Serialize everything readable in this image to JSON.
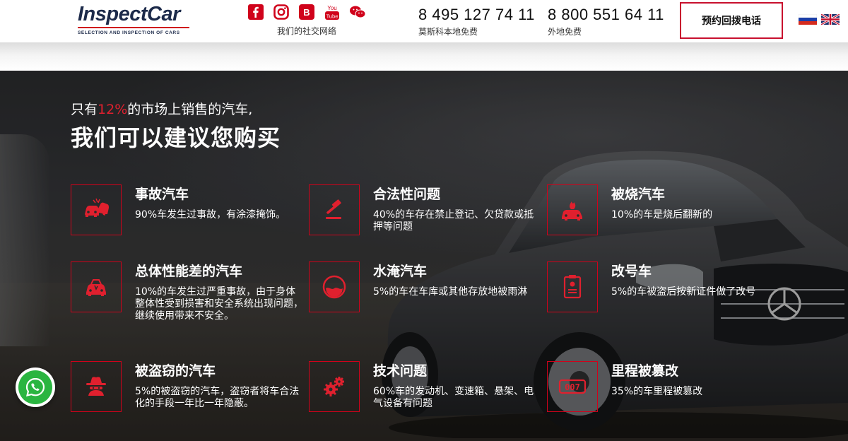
{
  "header": {
    "logo": {
      "name": "InspectCar",
      "tagline": "SELECTION AND INSPECTION OF CARS"
    },
    "social": {
      "icons": [
        "facebook-icon",
        "instagram-icon",
        "vk-icon",
        "youtube-icon",
        "wechat-icon"
      ],
      "label": "我们的社交网络"
    },
    "phones": [
      {
        "number": "8 495 127 74 11",
        "note": "莫斯科本地免费"
      },
      {
        "number": "8 800 551 64 11",
        "note": "外地免费"
      }
    ],
    "callback_label": "预约回拨电话",
    "languages": [
      "ru-flag",
      "uk-flag"
    ]
  },
  "hero": {
    "subtitle_prefix": "只有",
    "subtitle_highlight": "12%",
    "subtitle_suffix": "的市场上销售的汽车,",
    "title": "我们可以建议您购买",
    "accent_color": "#e0202e",
    "items": [
      {
        "title": "事故汽车",
        "desc": "90%车发生过事故，有涂漆掩饰。",
        "icon": "car-crash-icon"
      },
      {
        "title": "合法性问题",
        "desc": "40%的车存在禁止登记、欠贷款或抵押等问题",
        "icon": "gavel-icon"
      },
      {
        "title": "被烧汽车",
        "desc": "10%的车是烧后翻新的",
        "icon": "car-fire-icon"
      },
      {
        "title": "总体性能差的汽车",
        "desc": "10%的车发生过严重事故，由于身体整体性受到损害和安全系统出现问题，继续使用带来不安全。",
        "icon": "car-damaged-icon"
      },
      {
        "title": "水淹汽车",
        "desc": "5%的车在车库或其他存放地被雨淋",
        "icon": "water-icon"
      },
      {
        "title": "改号车",
        "desc": "5%的车被盗后按新证件做了改号",
        "icon": "document-icon"
      },
      {
        "title": "被盗窃的汽车",
        "desc": "5%的被盗窃的汽车，盗窃者将车合法化的手段一年比一年隐蔽。",
        "icon": "thief-icon"
      },
      {
        "title": "技术问题",
        "desc": "60%车的发动机、变速箱、悬架、电气设备有问题",
        "icon": "gears-icon"
      },
      {
        "title": "里程被篡改",
        "desc": "35%的车里程被篡改",
        "icon": "odometer-icon"
      }
    ]
  },
  "whatsapp": {
    "icon": "whatsapp-icon"
  }
}
